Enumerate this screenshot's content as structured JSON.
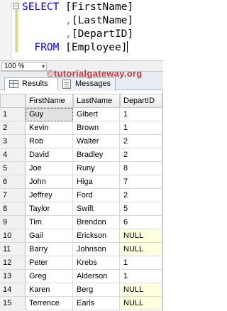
{
  "editor": {
    "lines": [
      {
        "indent": "",
        "kw": "SELECT",
        "punct": "",
        "text": " [FirstName]"
      },
      {
        "indent": "       ",
        "kw": "",
        "punct": ",",
        "text": "[LastName]"
      },
      {
        "indent": "       ",
        "kw": "",
        "punct": ",",
        "text": "[DepartID]"
      },
      {
        "indent": "  ",
        "kw": "FROM",
        "punct": "",
        "text": " [Employee]"
      }
    ],
    "collapse_glyph": "−"
  },
  "zoom": {
    "value": "100 %",
    "arrow": "▾"
  },
  "watermark": {
    "copyright": "©",
    "text": "tutorialgateway.org"
  },
  "tabs": [
    {
      "label": "Results",
      "icon": "grid-icon",
      "active": true
    },
    {
      "label": "Messages",
      "icon": "messages-icon",
      "active": false
    }
  ],
  "results": {
    "columns": [
      "FirstName",
      "LastName",
      "DepartID"
    ],
    "rows": [
      {
        "n": "1",
        "first": "Guy",
        "last": "Gibert",
        "dept": "1"
      },
      {
        "n": "2",
        "first": "Kevin",
        "last": "Brown",
        "dept": "1"
      },
      {
        "n": "3",
        "first": "Rob",
        "last": "Walter",
        "dept": "2"
      },
      {
        "n": "4",
        "first": "David",
        "last": "Bradley",
        "dept": "2"
      },
      {
        "n": "5",
        "first": "Joe",
        "last": "Runy",
        "dept": "8"
      },
      {
        "n": "6",
        "first": "John",
        "last": "Higa",
        "dept": "7"
      },
      {
        "n": "7",
        "first": "Jeffrey",
        "last": "Ford",
        "dept": "2"
      },
      {
        "n": "8",
        "first": "Taylor",
        "last": "Swift",
        "dept": "5"
      },
      {
        "n": "9",
        "first": "Tim",
        "last": "Brendon",
        "dept": "6"
      },
      {
        "n": "10",
        "first": "Gail",
        "last": "Erickson",
        "dept": "NULL"
      },
      {
        "n": "11",
        "first": "Barry",
        "last": "Johnson",
        "dept": "NULL"
      },
      {
        "n": "12",
        "first": "Peter",
        "last": "Krebs",
        "dept": "1"
      },
      {
        "n": "13",
        "first": "Greg",
        "last": "Alderson",
        "dept": "1"
      },
      {
        "n": "14",
        "first": "Karen",
        "last": "Berg",
        "dept": "NULL"
      },
      {
        "n": "15",
        "first": "Terrence",
        "last": "Earls",
        "dept": "NULL"
      }
    ],
    "null_label": "NULL"
  }
}
